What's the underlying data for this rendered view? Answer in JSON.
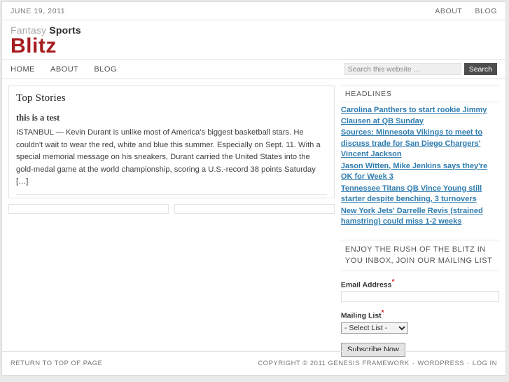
{
  "utility": {
    "date": "JUNE 19, 2011",
    "nav": [
      {
        "label": "ABOUT"
      },
      {
        "label": "BLOG"
      }
    ]
  },
  "logo": {
    "word1": "Fantasy",
    "word2": "Sports",
    "word3": "Blitz",
    "color_accent": "#a61c20",
    "color_muted": "#a8a8a8"
  },
  "nav": {
    "items": [
      {
        "label": "HOME"
      },
      {
        "label": "ABOUT"
      },
      {
        "label": "BLOG"
      }
    ]
  },
  "search": {
    "placeholder": "Search this website …",
    "value": "",
    "button_label": "Search"
  },
  "content": {
    "title": "Top Stories",
    "post": {
      "title": "this is a test",
      "excerpt": "ISTANBUL — Kevin Durant is unlike most of America's biggest basketball stars. He couldn't wait to wear the red, white and blue this summer. Especially on Sept. 11. With a special memorial message on his sneakers, Durant carried the United States into the gold-medal game at the world championship, scoring a U.S.-record 38 points Saturday […]"
    }
  },
  "sidebar": {
    "headlines_title": "HEADLINES",
    "headlines": [
      {
        "label": "Carolina Panthers to start rookie Jimmy Clausen at QB Sunday"
      },
      {
        "label": "Sources: Minnesota Vikings to meet to discuss trade for San Diego Chargers' Vincent Jackson"
      },
      {
        "label": "Jason Witten, Mike Jenkins says they're OK for Week 3"
      },
      {
        "label": "Tennessee Titans QB Vince Young still starter despite benching, 3 turnovers"
      },
      {
        "label": "New York Jets' Darrelle Revis (strained hamstring) could miss 1-2 weeks"
      }
    ],
    "link_color": "#2e7cb0",
    "mailing": {
      "heading": "ENJOY THE RUSH OF THE BLITZ IN YOU INBOX, JOIN OUR MAILING LIST",
      "email_label": "Email Address",
      "email_value": "",
      "list_label": "Mailing List",
      "list_selected": "- Select List -",
      "list_options": [
        "- Select List -"
      ],
      "required_marker": "*",
      "submit_label": "Subscribe Now"
    }
  },
  "footer": {
    "top_link": "RETURN TO TOP OF PAGE",
    "copyright": "COPYRIGHT © 2011 GENESIS FRAMEWORK",
    "sep1": "·",
    "wordpress": "WORDPRESS",
    "sep2": "·",
    "login": "LOG IN"
  }
}
